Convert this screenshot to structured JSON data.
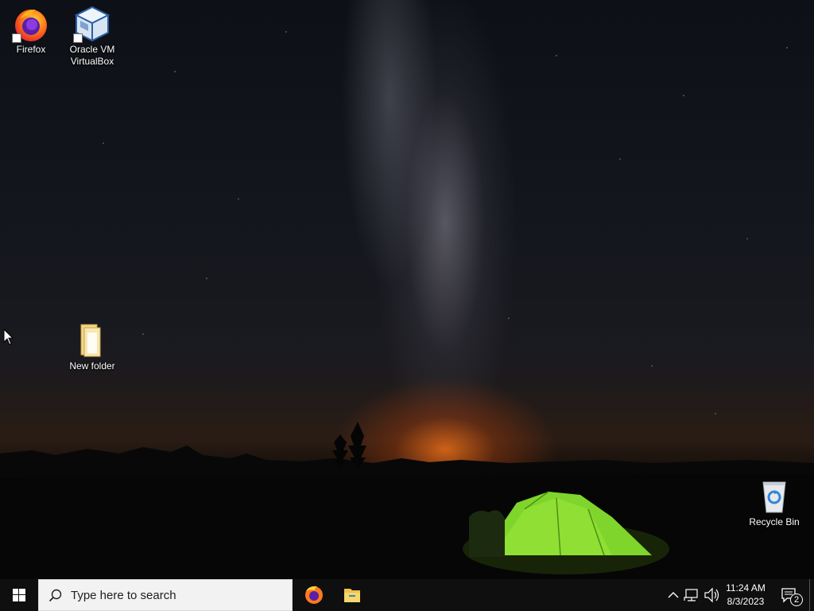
{
  "desktop": {
    "icons": [
      {
        "label": "Firefox"
      },
      {
        "label": "Oracle VM\nVirtualBox"
      },
      {
        "label": "New folder"
      },
      {
        "label": "Recycle Bin"
      }
    ]
  },
  "taskbar": {
    "search_placeholder": "Type here to search",
    "pinned_apps": [
      "firefox-icon",
      "file-explorer-icon"
    ],
    "tray": {
      "time": "11:24 AM",
      "date": "8/3/2023",
      "notification_count": "2"
    }
  },
  "colors": {
    "taskbar": "#0f0f10",
    "search_box": "#f2f2f2",
    "start_logo": "#ffffff",
    "tent": "#7fd52b",
    "horizon_glow": "#e86a1a"
  }
}
